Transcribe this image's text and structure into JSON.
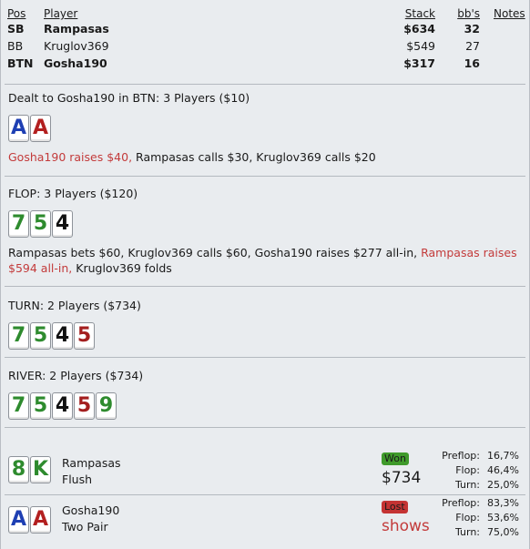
{
  "header": {
    "pos": "Pos",
    "player": "Player",
    "stack": "Stack",
    "bbs": "bb's",
    "notes": "Notes"
  },
  "players": [
    {
      "pos": "SB",
      "name": "Rampasas",
      "stack": "$634",
      "bbs": "32",
      "bold": true
    },
    {
      "pos": "BB",
      "name": "Kruglov369",
      "stack": "$549",
      "bbs": "27",
      "bold": false
    },
    {
      "pos": "BTN",
      "name": "Gosha190",
      "stack": "$317",
      "bbs": "16",
      "bold": true
    }
  ],
  "preflop": {
    "title": "Dealt to Gosha190 in BTN: 3 Players ($10)",
    "cards": [
      {
        "rank": "A",
        "color": "#1e3fb3"
      },
      {
        "rank": "A",
        "color": "#b32020"
      }
    ],
    "action_hero": "Gosha190 raises $40,",
    "action_rest": " Rampasas calls $30, Kruglov369 calls $20"
  },
  "flop": {
    "title": "FLOP: 3 Players ($120)",
    "cards": [
      {
        "rank": "7",
        "color": "#2e8b2e"
      },
      {
        "rank": "5",
        "color": "#2e8b2e"
      },
      {
        "rank": "4",
        "color": "#111111"
      }
    ],
    "action_a": "Rampasas bets $60, Kruglov369 calls $60, Gosha190 raises $277 all-in, ",
    "action_red": "Rampasas raises $594 all-in,",
    "action_b": " Kruglov369 folds"
  },
  "turn": {
    "title": "TURN: 2 Players ($734)",
    "cards": [
      {
        "rank": "7",
        "color": "#2e8b2e"
      },
      {
        "rank": "5",
        "color": "#2e8b2e"
      },
      {
        "rank": "4",
        "color": "#111111"
      },
      {
        "rank": "5",
        "color": "#a31e1e"
      }
    ]
  },
  "river": {
    "title": "RIVER: 2 Players ($734)",
    "cards": [
      {
        "rank": "7",
        "color": "#2e8b2e"
      },
      {
        "rank": "5",
        "color": "#2e8b2e"
      },
      {
        "rank": "4",
        "color": "#111111"
      },
      {
        "rank": "5",
        "color": "#a31e1e"
      },
      {
        "rank": "9",
        "color": "#2e8b2e"
      }
    ]
  },
  "showdown": [
    {
      "cards": [
        {
          "rank": "8",
          "color": "#2e8b2e"
        },
        {
          "rank": "K",
          "color": "#2e8b2e"
        }
      ],
      "name": "Rampasas",
      "hand": "Flush",
      "result": "Won",
      "amount": "$734",
      "stats": [
        {
          "label": "Preflop:",
          "value": "16,7%"
        },
        {
          "label": "Flop:",
          "value": "46,4%"
        },
        {
          "label": "Turn:",
          "value": "25,0%"
        }
      ]
    },
    {
      "cards": [
        {
          "rank": "A",
          "color": "#1e3fb3"
        },
        {
          "rank": "A",
          "color": "#b32020"
        }
      ],
      "name": "Gosha190",
      "hand": "Two Pair",
      "result": "Lost",
      "amount": "shows",
      "stats": [
        {
          "label": "Preflop:",
          "value": "83,3%"
        },
        {
          "label": "Flop:",
          "value": "53,6%"
        },
        {
          "label": "Turn:",
          "value": "75,0%"
        }
      ]
    }
  ],
  "colors": {
    "red_text": "#c33b3b",
    "won_badge": "#3f9a2b",
    "lost_badge": "#c43333"
  }
}
